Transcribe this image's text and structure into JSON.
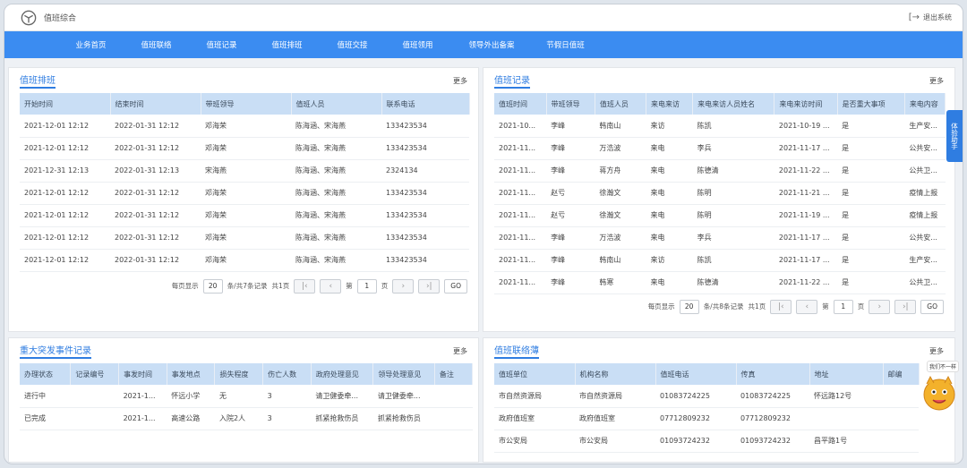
{
  "app": {
    "title": "值班综合",
    "logout": "退出系统"
  },
  "nav": [
    "业务首页",
    "值班联络",
    "值班记录",
    "值班排班",
    "值班交接",
    "值班领用",
    "领导外出备案",
    "节假日值班"
  ],
  "schedule": {
    "title": "值班排班",
    "more": "更多",
    "columns": [
      "开始时间",
      "结束时间",
      "带班领导",
      "值班人员",
      "联系电话"
    ],
    "rows": [
      [
        "2021-12-01 12:12",
        "2022-01-31 12:12",
        "邓海荣",
        "陈海涵、宋海燕",
        "133423534"
      ],
      [
        "2021-12-01 12:12",
        "2022-01-31 12:12",
        "邓海荣",
        "陈海涵、宋海燕",
        "133423534"
      ],
      [
        "2021-12-31 12:13",
        "2022-01-31 12:13",
        "宋海燕",
        "陈海涵、宋海燕",
        "2324134"
      ],
      [
        "2021-12-01 12:12",
        "2022-01-31 12:12",
        "邓海荣",
        "陈海涵、宋海燕",
        "133423534"
      ],
      [
        "2021-12-01 12:12",
        "2022-01-31 12:12",
        "邓海荣",
        "陈海涵、宋海燕",
        "133423534"
      ],
      [
        "2021-12-01 12:12",
        "2022-01-31 12:12",
        "邓海荣",
        "陈海涵、宋海燕",
        "133423534"
      ],
      [
        "2021-12-01 12:12",
        "2022-01-31 12:12",
        "邓海荣",
        "陈海涵、宋海燕",
        "133423534"
      ]
    ],
    "pager": {
      "per_page_label": "每页显示",
      "per_page": "20",
      "summary": "条/共7条记录",
      "total_pages": "共1页",
      "page_prefix": "第",
      "page": "1",
      "page_suffix": "页",
      "go": "GO"
    }
  },
  "records": {
    "title": "值班记录",
    "more": "更多",
    "columns": [
      "值班时间",
      "带班领导",
      "值班人员",
      "来电来访",
      "来电来访人员姓名",
      "来电来访时间",
      "是否重大事项",
      "来电内容"
    ],
    "rows": [
      [
        "2021-10...",
        "李峰",
        "韩南山",
        "来访",
        "陈凯",
        "2021-10-19 ...",
        "是",
        "生产安..."
      ],
      [
        "2021-11...",
        "李峰",
        "万浩波",
        "来电",
        "李兵",
        "2021-11-17 ...",
        "是",
        "公共安..."
      ],
      [
        "2021-11...",
        "李峰",
        "蒋方舟",
        "来电",
        "陈德清",
        "2021-11-22 ...",
        "是",
        "公共卫..."
      ],
      [
        "2021-11...",
        "赵亏",
        "徐瀚文",
        "来电",
        "陈明",
        "2021-11-21 ...",
        "是",
        "疫情上报"
      ],
      [
        "2021-11...",
        "赵亏",
        "徐瀚文",
        "来电",
        "陈明",
        "2021-11-19 ...",
        "是",
        "疫情上报"
      ],
      [
        "2021-11...",
        "李峰",
        "万浩波",
        "来电",
        "李兵",
        "2021-11-17 ...",
        "是",
        "公共安..."
      ],
      [
        "2021-11...",
        "李峰",
        "韩南山",
        "来访",
        "陈凯",
        "2021-11-17 ...",
        "是",
        "生产安..."
      ],
      [
        "2021-11...",
        "李峰",
        "韩寒",
        "来电",
        "陈德清",
        "2021-11-22 ...",
        "是",
        "公共卫..."
      ]
    ],
    "pager": {
      "per_page_label": "每页显示",
      "per_page": "20",
      "summary": "条/共8条记录",
      "total_pages": "共1页",
      "page_prefix": "第",
      "page": "1",
      "page_suffix": "页",
      "go": "GO"
    }
  },
  "incidents": {
    "title": "重大突发事件记录",
    "more": "更多",
    "columns": [
      "办理状态",
      "记录编号",
      "事发时间",
      "事发地点",
      "损失程度",
      "伤亡人数",
      "政府处理意见",
      "领导处理意见",
      "备注"
    ],
    "rows": [
      [
        "进行中",
        "",
        "2021-1...",
        "怀远小学",
        "无",
        "3",
        "请卫健委牵...",
        "请卫健委牵...",
        ""
      ],
      [
        "已完成",
        "",
        "2021-1...",
        "高速公路",
        "入院2人",
        "3",
        "抓紧抢救伤员",
        "抓紧抢救伤员",
        ""
      ]
    ]
  },
  "contacts": {
    "title": "值班联络薄",
    "more": "更多",
    "columns": [
      "值班单位",
      "机构名称",
      "值班电话",
      "传真",
      "地址",
      "邮编"
    ],
    "rows": [
      [
        "市自然资源局",
        "市自然资源局",
        "01083724225",
        "01083724225",
        "怀远路12号",
        ""
      ],
      [
        "政府值班室",
        "政府值班室",
        "07712809232",
        "07712809232",
        "",
        ""
      ],
      [
        "市公安局",
        "市公安局",
        "01093724232",
        "01093724232",
        "昌平路1号",
        ""
      ]
    ]
  },
  "side_tab": "体验助手",
  "mascot_text": "我们不一样",
  "colors": {
    "primary": "#3b8cf1",
    "header_bg": "#c9def5"
  }
}
